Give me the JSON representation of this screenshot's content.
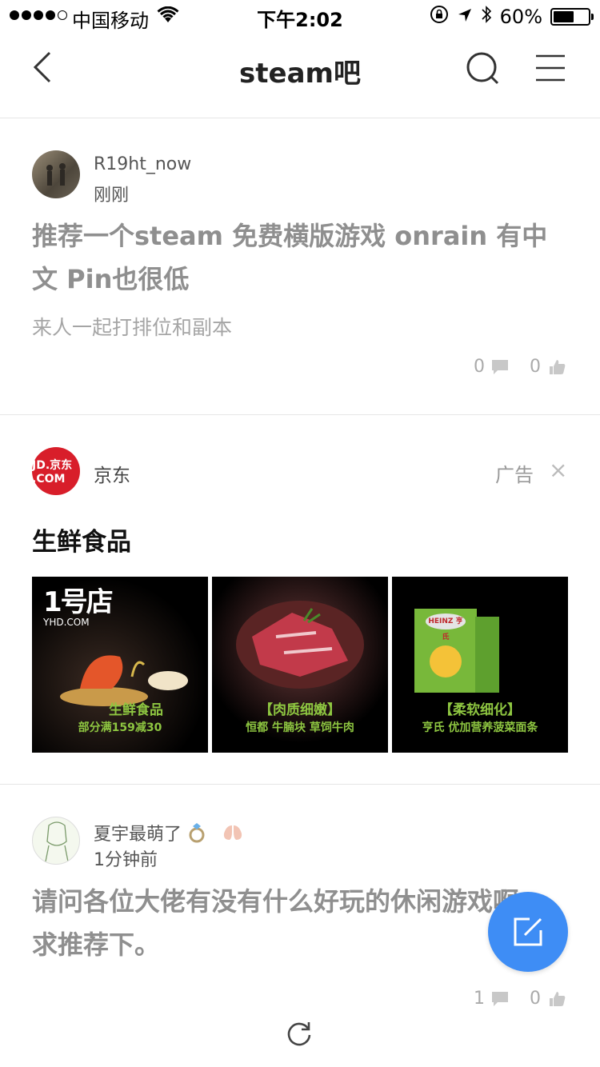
{
  "status_bar": {
    "carrier": "中国移动",
    "time": "下午2:02",
    "battery": "60%",
    "battery_level": 0.6
  },
  "nav": {
    "title": "steam吧",
    "icons": [
      "back-icon",
      "search-icon",
      "menu-icon"
    ]
  },
  "posts": [
    {
      "username": "R19ht_now",
      "time": "刚刚",
      "title": "推荐一个steam 免费横版游戏 onrain 有中文 Pin也很低",
      "subtitle": "来人一起打排位和副本",
      "comments": "0",
      "likes": "0"
    },
    {
      "username": "夏宇最萌了",
      "time": "1分钟前",
      "title": "请问各位大佬有没有什么好玩的休闲游戏啊，求推荐下。",
      "comments": "1",
      "likes": "0"
    }
  ],
  "ad": {
    "advertiser": "京东",
    "logo_text": "JD.京东 .COM",
    "tag": "广告",
    "close": "×",
    "headline": "生鲜食品",
    "images": [
      {
        "brand": "1号店",
        "brand_sub": "YHD.COM",
        "caption": "生鲜食品",
        "caption2": "部分满159减30"
      },
      {
        "caption": "【肉质细嫩】",
        "caption2": "恒都 牛腩块 草饲牛肉"
      },
      {
        "brand": "HEINZ 亨氏",
        "caption": "【柔软细化】",
        "caption2": "亨氏 优加营养菠菜面条"
      }
    ]
  },
  "colors": {
    "accent": "#3e8df5",
    "jd_red": "#d81e2a",
    "caption_green": "#8ec641"
  }
}
